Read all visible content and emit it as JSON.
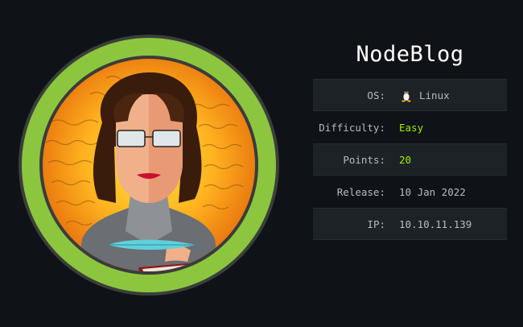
{
  "machine": {
    "name": "NodeBlog",
    "rows": [
      {
        "label": "OS:",
        "value": "Linux",
        "icon": "linux-penguin-icon"
      },
      {
        "label": "Difficulty:",
        "value": "Easy",
        "accent": "#9fef00"
      },
      {
        "label": "Points:",
        "value": "20",
        "accent": "#9fef00"
      },
      {
        "label": "Release:",
        "value": "10 Jan 2022"
      },
      {
        "label": "IP:",
        "value": "10.10.11.139"
      }
    ]
  },
  "colors": {
    "background": "#0f1216",
    "ring": "#8cc63f",
    "accent": "#9fef00",
    "row_shade": "#1d2227"
  },
  "avatar": {
    "icon": "machine-avatar-icon",
    "description_icons": [
      "writer-woman-icon",
      "quill-pen-icon",
      "book-icon"
    ]
  }
}
